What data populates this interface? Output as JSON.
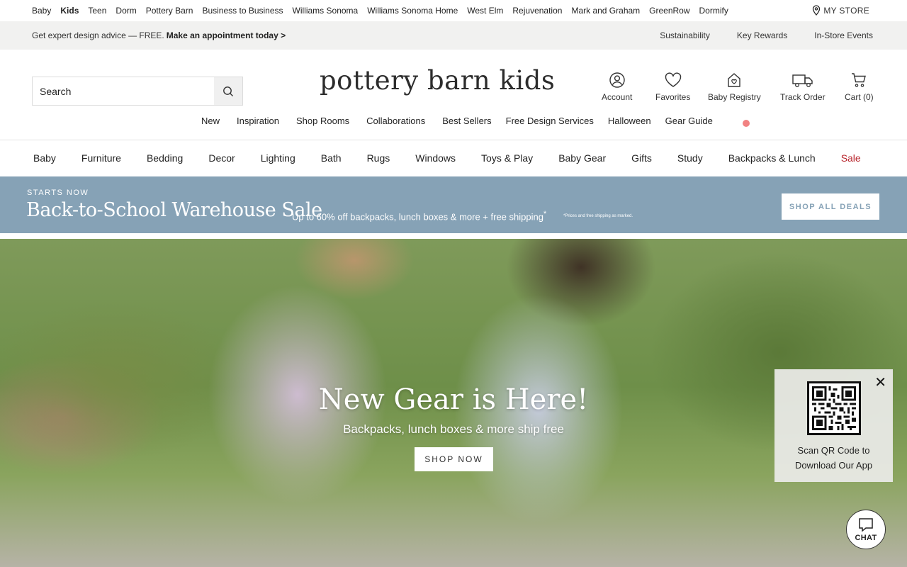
{
  "brand_links": [
    {
      "label": "Baby",
      "active": false
    },
    {
      "label": "Kids",
      "active": true
    },
    {
      "label": "Teen",
      "active": false
    },
    {
      "label": "Dorm",
      "active": false
    },
    {
      "label": "Pottery Barn",
      "active": false
    },
    {
      "label": "Business to Business",
      "active": false
    },
    {
      "label": "Williams Sonoma",
      "active": false
    },
    {
      "label": "Williams Sonoma Home",
      "active": false
    },
    {
      "label": "West Elm",
      "active": false
    },
    {
      "label": "Rejuvenation",
      "active": false
    },
    {
      "label": "Mark and Graham",
      "active": false
    },
    {
      "label": "GreenRow",
      "active": false
    },
    {
      "label": "Dormify",
      "active": false
    }
  ],
  "my_store": "MY STORE",
  "promo": {
    "text": "Get expert design advice — FREE.",
    "link": "Make an appointment today >",
    "right_links": [
      "Sustainability",
      "Key Rewards",
      "In-Store Events"
    ]
  },
  "search": {
    "placeholder": "Search"
  },
  "logo": "pottery barn kids",
  "utility": {
    "account": "Account",
    "favorites": "Favorites",
    "registry": "Baby Registry",
    "track": "Track Order",
    "cart": "Cart (0)"
  },
  "subnav": [
    "New",
    "Inspiration",
    "Shop Rooms",
    "Collaborations",
    "Best Sellers",
    "Free Design Services",
    "Halloween",
    "Gear Guide"
  ],
  "categories": [
    "Baby",
    "Furniture",
    "Bedding",
    "Decor",
    "Lighting",
    "Bath",
    "Rugs",
    "Windows",
    "Toys & Play",
    "Baby Gear",
    "Gifts",
    "Study",
    "Backpacks & Lunch",
    "Sale"
  ],
  "sale_banner": {
    "kicker": "STARTS NOW",
    "title": "Back-to-School Warehouse Sale",
    "subtitle": "Up to 60% off backpacks, lunch boxes & more + free shipping",
    "asterisk": "*",
    "fine_print": "*Prices and free shipping as marked.",
    "button": "SHOP ALL DEALS",
    "color": "#86a2b6"
  },
  "hero": {
    "title": "New Gear is Here!",
    "subtitle": "Backpacks, lunch boxes & more ship free",
    "button": "SHOP NOW"
  },
  "qr": {
    "line1": "Scan QR Code to",
    "line2": "Download Our App"
  },
  "chat": {
    "label": "CHAT"
  },
  "colors": {
    "sale": "#b8252c"
  }
}
